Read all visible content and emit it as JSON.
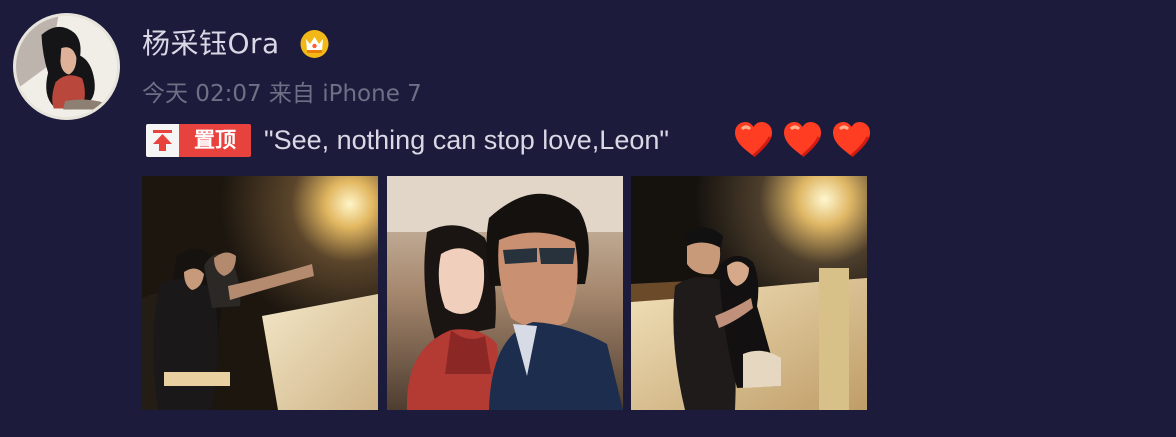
{
  "post": {
    "username": "杨采钰Ora",
    "badge_icon": "crown-badge-icon",
    "time": "今天 02:07",
    "source_prefix": "来自",
    "device": "iPhone 7",
    "pinned_label": "置顶",
    "text": "\"See, nothing can stop love,Leon\"",
    "emoji": [
      "heart-icon",
      "heart-icon",
      "heart-icon"
    ],
    "photos": [
      "night-terrace-photo",
      "selfie-photo",
      "night-balcony-photo"
    ]
  },
  "colors": {
    "background": "#1d1b3b",
    "meta_text": "#6f6f86",
    "pinned_red": "#e8423e",
    "heart_red": "#ff3d22"
  }
}
